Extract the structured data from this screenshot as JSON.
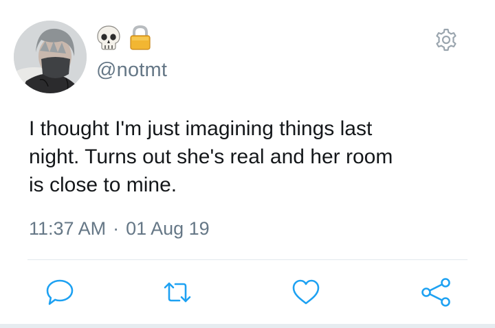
{
  "user": {
    "display_name_icons": [
      "skull-emoji",
      "lock-emoji"
    ],
    "handle": "@notmt"
  },
  "tweet": {
    "text": "I thought I'm just imagining things last\nnight. Turns out she's real and her room\nis close to mine.",
    "time": "11:37 AM",
    "separator": "·",
    "date": "01 Aug 19"
  },
  "actions": [
    {
      "name": "reply",
      "icon": "reply-icon"
    },
    {
      "name": "retweet",
      "icon": "retweet-icon"
    },
    {
      "name": "like",
      "icon": "heart-icon"
    },
    {
      "name": "share",
      "icon": "share-icon"
    }
  ],
  "header": {
    "settings_icon": "gear-icon"
  },
  "colors": {
    "text": "#14171a",
    "secondary": "#657786",
    "icon": "#1da1f2",
    "divider": "#e1e8ed"
  }
}
